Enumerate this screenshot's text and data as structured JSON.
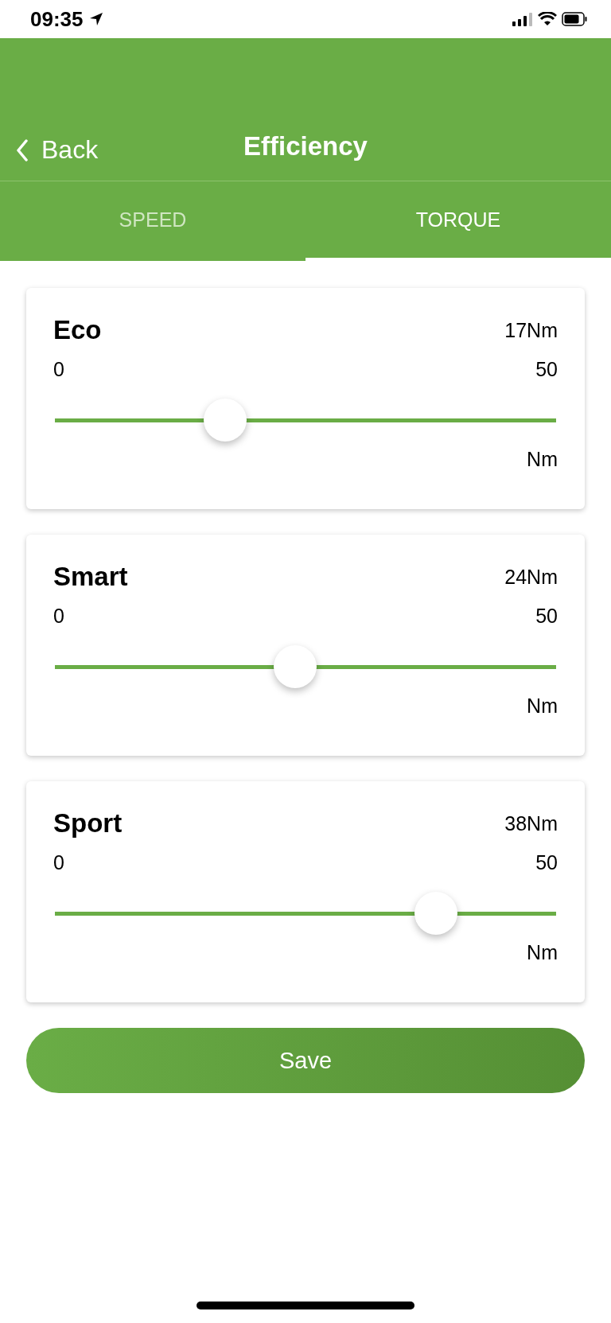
{
  "status_bar": {
    "time": "09:35"
  },
  "nav": {
    "back": "Back",
    "title": "Efficiency"
  },
  "tabs": [
    {
      "label": "SPEED",
      "selected": false
    },
    {
      "label": "TORQUE",
      "selected": true
    }
  ],
  "modes": [
    {
      "name": "Eco",
      "reading": "17Nm",
      "min": "0",
      "max": "50",
      "unit": "Nm",
      "level": 0.34
    },
    {
      "name": "Smart",
      "reading": "24Nm",
      "min": "0",
      "max": "50",
      "unit": "Nm",
      "level": 0.48
    },
    {
      "name": "Sport",
      "reading": "38Nm",
      "min": "0",
      "max": "50",
      "unit": "Nm",
      "level": 0.76
    }
  ],
  "save_button": "Save"
}
